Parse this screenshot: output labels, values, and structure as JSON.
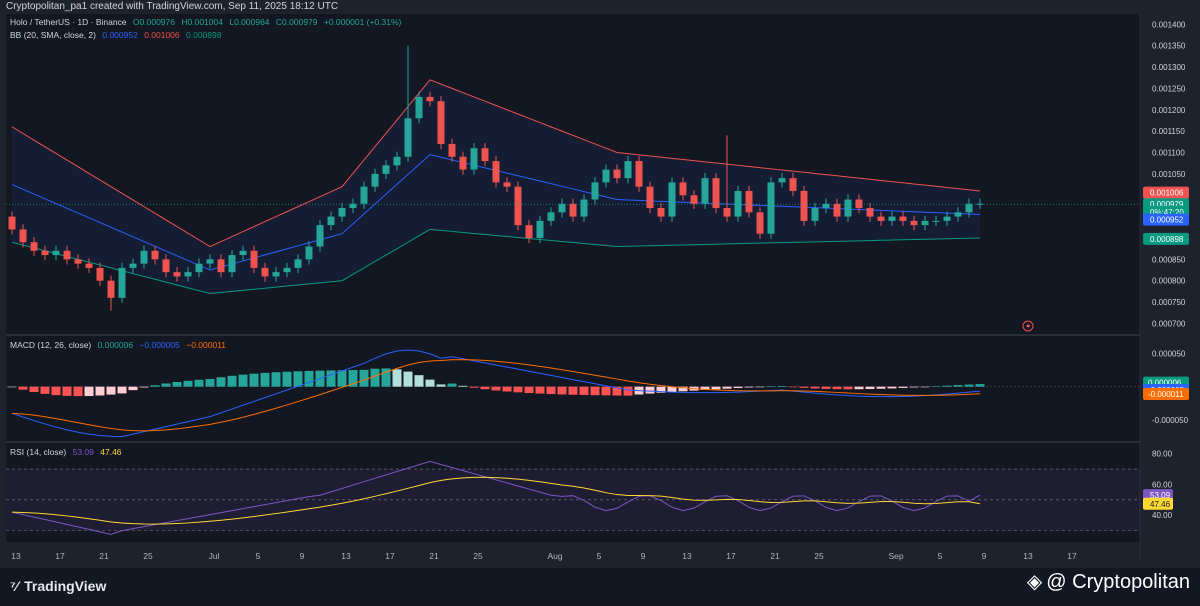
{
  "header": {
    "text": "Cryptopolitan_pa1 created with TradingView.com, Sep 11, 2025 18:12 UTC"
  },
  "symbol_legend": {
    "name": "Holo / TetherUS · 1D · Binance",
    "open": "O0.000976",
    "high": "H0.001004",
    "low": "L0.000964",
    "close": "C0.000979",
    "change": "+0.000001 (+0.31%)"
  },
  "bb_legend": {
    "label": "BB (20, SMA, close, 2)",
    "basis": "0.000952",
    "upper": "0.001006",
    "lower": "0.000898"
  },
  "macd_legend": {
    "label": "MACD (12, 26, close)",
    "hist": "0.000006",
    "macd": "−0.000005",
    "signal": "−0.000011"
  },
  "rsi_legend": {
    "label": "RSI (14, close)",
    "rsi": "53.09",
    "ma": "47.46"
  },
  "colors": {
    "up": "#26a69a",
    "down": "#ef5350",
    "bb_upper": "#ef5350",
    "bb_lower": "#089981",
    "bb_basis": "#2962ff",
    "macd": "#2962ff",
    "signal": "#ff6d00",
    "rsi": "#7e57c2",
    "rsi_ma": "#fdd835"
  },
  "price_axis": [
    "0.001400",
    "0.001350",
    "0.001300",
    "0.001250",
    "0.001200",
    "0.001150",
    "0.001100",
    "0.001050",
    "0.000850",
    "0.000800",
    "0.000750",
    "0.000700"
  ],
  "price_tags": [
    {
      "text": "0.001006",
      "color": "#ef5350",
      "value": 0.001006
    },
    {
      "text": "0.000979",
      "color": "#089981",
      "value": 0.000979
    },
    {
      "text": "0%:47:20",
      "color": "#089981",
      "value": 0.000961
    },
    {
      "text": "0.000952",
      "color": "#2962ff",
      "value": 0.000943
    },
    {
      "text": "0.000898",
      "color": "#089981",
      "value": 0.000898
    }
  ],
  "macd_axis": [
    "0.000050",
    "-0.000050"
  ],
  "macd_tags": [
    {
      "text": "0.000006",
      "color": "#089981",
      "value": 6e-06
    },
    {
      "text": "-0.000005",
      "color": "#2962ff",
      "value": -5e-06
    },
    {
      "text": "-0.000011",
      "color": "#ff6d00",
      "value": -1.1e-05
    }
  ],
  "rsi_axis": [
    "80.00",
    "60.00",
    "40.00"
  ],
  "rsi_tags": [
    {
      "text": "53.09",
      "color": "#7e57c2",
      "value": 53.09
    },
    {
      "text": "47.46",
      "color": "#fdd835",
      "value": 47.46
    }
  ],
  "x_labels": [
    {
      "i": 0,
      "t": "13"
    },
    {
      "i": 4,
      "t": "17"
    },
    {
      "i": 8,
      "t": "21"
    },
    {
      "i": 12,
      "t": "25"
    },
    {
      "i": 18,
      "t": "Jul"
    },
    {
      "i": 22,
      "t": "5"
    },
    {
      "i": 26,
      "t": "9"
    },
    {
      "i": 30,
      "t": "13"
    },
    {
      "i": 34,
      "t": "17"
    },
    {
      "i": 38,
      "t": "21"
    },
    {
      "i": 42,
      "t": "25"
    },
    {
      "i": 49,
      "t": "Aug"
    },
    {
      "i": 53,
      "t": "5"
    },
    {
      "i": 57,
      "t": "9"
    },
    {
      "i": 61,
      "t": "13"
    },
    {
      "i": 65,
      "t": "17"
    },
    {
      "i": 69,
      "t": "21"
    },
    {
      "i": 73,
      "t": "25"
    },
    {
      "i": 80,
      "t": "Sep"
    },
    {
      "i": 84,
      "t": "5"
    },
    {
      "i": 88,
      "t": "9"
    },
    {
      "i": 92,
      "t": "13"
    },
    {
      "i": 96,
      "t": "17"
    }
  ],
  "footer": {
    "tv_logo": "TradingView",
    "brand": "@ Cryptopolitan"
  },
  "chart_data": {
    "type": "candlestick",
    "title": "Holo / TetherUS · 1D · Binance",
    "ylim": [
      0.00068,
      0.00141
    ],
    "closes": [
      0.00092,
      0.00089,
      0.00087,
      0.00086,
      0.00087,
      0.00085,
      0.00084,
      0.00083,
      0.0008,
      0.00076,
      0.00083,
      0.00084,
      0.00087,
      0.00085,
      0.00082,
      0.00081,
      0.00082,
      0.00084,
      0.00085,
      0.00082,
      0.00086,
      0.00087,
      0.00083,
      0.00081,
      0.00082,
      0.00083,
      0.00085,
      0.00088,
      0.00093,
      0.00095,
      0.00097,
      0.00098,
      0.00102,
      0.00105,
      0.00107,
      0.00109,
      0.00118,
      0.00123,
      0.00122,
      0.00112,
      0.00109,
      0.00106,
      0.00111,
      0.00108,
      0.00103,
      0.00102,
      0.00093,
      0.0009,
      0.00094,
      0.00096,
      0.00098,
      0.00095,
      0.00099,
      0.00103,
      0.00106,
      0.00104,
      0.00108,
      0.00102,
      0.00097,
      0.00095,
      0.00103,
      0.001,
      0.00098,
      0.00104,
      0.00097,
      0.00095,
      0.00101,
      0.00096,
      0.00091,
      0.00103,
      0.00104,
      0.00101,
      0.00094,
      0.00097,
      0.00098,
      0.00095,
      0.00099,
      0.00097,
      0.00095,
      0.00094,
      0.00095,
      0.00094,
      0.00093,
      0.00094,
      0.00094,
      0.00095,
      0.00096,
      0.00098,
      0.00098
    ],
    "bb_upper_start": 0.00116,
    "bb_upper_peak": 0.00127,
    "bb_upper_end": 0.00101,
    "bb_lower_start": 0.00089,
    "bb_lower_min": 0.00077,
    "bb_lower_end": 0.0009,
    "macd_range": [
      -8e-05,
      7e-05
    ],
    "rsi_range": [
      20,
      85
    ],
    "rsi_last": 53.09,
    "rsi_ma_last": 47.46
  }
}
